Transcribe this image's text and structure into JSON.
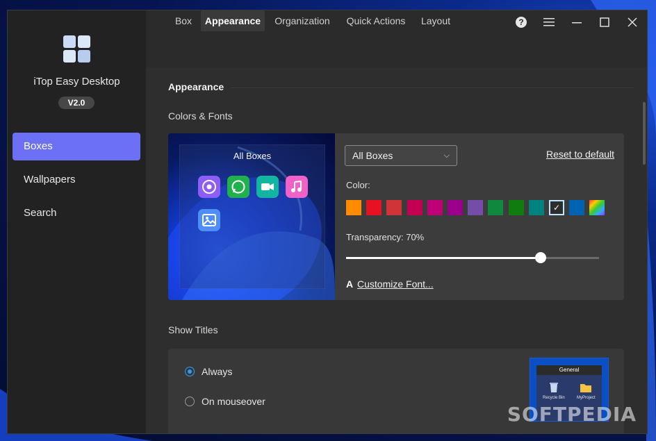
{
  "app": {
    "name": "iTop Easy Desktop",
    "version": "V2.0"
  },
  "sidebar": {
    "items": [
      {
        "label": "Boxes",
        "active": true
      },
      {
        "label": "Wallpapers",
        "active": false
      },
      {
        "label": "Search",
        "active": false
      }
    ]
  },
  "titlebar": {
    "help_icon": "question-icon",
    "menu_icon": "hamburger-icon",
    "minimize": "minimize-icon",
    "maximize": "maximize-icon",
    "close": "close-icon"
  },
  "tabs": [
    {
      "label": "Box",
      "active": false
    },
    {
      "label": "Appearance",
      "active": true
    },
    {
      "label": "Organization",
      "active": false
    },
    {
      "label": "Quick Actions",
      "active": false
    },
    {
      "label": "Layout",
      "active": false
    }
  ],
  "appearance": {
    "section_title": "Appearance",
    "colors_fonts_title": "Colors & Fonts",
    "preview": {
      "box_title": "All Boxes",
      "icons": [
        "chrome-icon",
        "whatsapp-icon",
        "video-call-icon",
        "music-icon",
        "photos-icon"
      ]
    },
    "box_select": {
      "value": "All Boxes"
    },
    "reset_label": "Reset to default",
    "color_label": "Color:",
    "colors": [
      "#ff8c00",
      "#e81123",
      "#d13438",
      "#c30052",
      "#bf0077",
      "#9a0089",
      "#744da9",
      "#10893e",
      "#107c10",
      "#00827f",
      "#2d2d2d",
      "#0063b1",
      "#rainbow"
    ],
    "selected_color_index": 10,
    "transparency_label": "Transparency: 70%",
    "transparency_value": 0.77,
    "customize_font_label": "Customize Font...",
    "customize_font_glyph": "A"
  },
  "show_titles": {
    "title": "Show Titles",
    "options": [
      {
        "label": "Always",
        "checked": true
      },
      {
        "label": "On mouseover",
        "checked": false
      }
    ],
    "preview": {
      "header": "General",
      "items": [
        "Recycle Bin",
        "MyProject"
      ]
    }
  },
  "watermark": "SOFTPEDIA"
}
